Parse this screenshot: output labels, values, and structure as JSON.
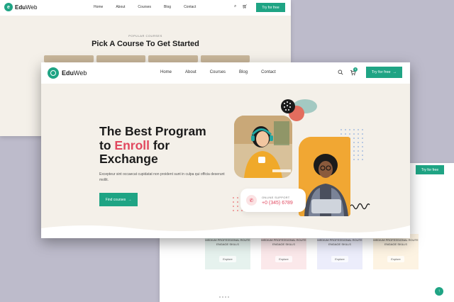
{
  "back_left": {
    "logo": {
      "brand_bold": "Edu",
      "brand_light": "Web"
    },
    "nav": [
      "Home",
      "About",
      "Courses",
      "Blog",
      "Contact"
    ],
    "cta": "Try for free",
    "subtitle": "POPULAR COURSES",
    "title": "Pick A Course To Get Started"
  },
  "back_right": {
    "cta": "Try for free",
    "cards": [
      {
        "caption": "MEDIUM PROFESSIONAL ROUTE",
        "caption2": "ENGAGE SKILLS",
        "pill": "Explore",
        "color": "#e6f2ee"
      },
      {
        "caption": "MEDIUM PROFESSIONAL ROUTE",
        "caption2": "ENGAGE SKILLS",
        "pill": "Explore",
        "color": "#fbe8ea"
      },
      {
        "caption": "MEDIUM PROFESSIONAL ROUTE",
        "caption2": "ENGAGE SKILLS",
        "pill": "Explore",
        "color": "#ecedfb"
      },
      {
        "caption": "MEDIUM PROFESSIONAL ROUTE",
        "caption2": "ENGAGE SKILLS",
        "pill": "Explore",
        "color": "#fdf3e2"
      }
    ]
  },
  "front": {
    "logo": {
      "brand_bold": "Edu",
      "brand_light": "Web"
    },
    "nav": [
      "Home",
      "About",
      "Courses",
      "Blog",
      "Contact"
    ],
    "cart_count": "0",
    "try_button": "Try for free",
    "hero": {
      "title_line1": "The Best Program",
      "title_pre": "to ",
      "title_accent": "Enroll",
      "title_post": " for",
      "title_line3": "Exchange",
      "description": "Excepteur sint occaecat cupidatat non proident sunt in culpa qui officia deserunt mollit.",
      "cta": "Find courses"
    },
    "support": {
      "label": "ONLINE SUPPORT",
      "phone": "+0 (345) 6789"
    },
    "icons": [
      "search-icon",
      "cart-icon",
      "arrow-right-icon",
      "phone-icon"
    ]
  },
  "colors": {
    "primary": "#1fa484",
    "accent": "#e1485f",
    "hero_bg": "#f4f0e9",
    "backdrop": "#bdbbcb"
  }
}
